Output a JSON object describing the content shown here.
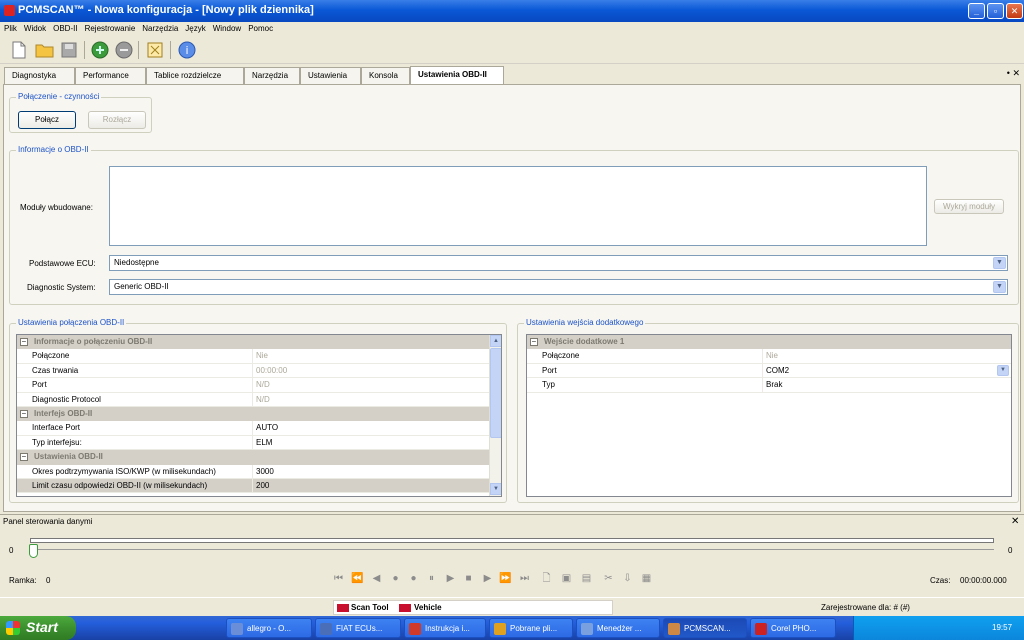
{
  "window": {
    "title": "PCMSCAN™ - Nowa konfiguracja - [Nowy plik dziennika]"
  },
  "menu": [
    "Plik",
    "Widok",
    "OBD-II",
    "Rejestrowanie",
    "Narzędzia",
    "Język",
    "Window",
    "Pomoc"
  ],
  "toolbar": {
    "icons": [
      "new-file-icon",
      "open-folder-icon",
      "save-icon",
      "connect-icon",
      "disconnect-icon",
      "settings-icon",
      "help-icon"
    ]
  },
  "tabs": [
    "Diagnostyka",
    "Performance",
    "Tablice rozdzielcze",
    "Narzędzia",
    "Ustawienia",
    "Konsola",
    "Ustawienia OBD-II"
  ],
  "tabs_active": "Ustawienia OBD-II",
  "tab_controls": {
    "pin": "•",
    "close": "✕"
  },
  "connection_group": {
    "title": "Połączenie - czynności",
    "connect_label": "Połącz",
    "disconnect_label": "Rozłącz"
  },
  "obd_info": {
    "title": "Informacje o OBD-II",
    "modules_label": "Moduły wbudowane:",
    "detect_label": "Wykryj moduły",
    "base_ecu_label": "Podstawowe ECU:",
    "base_ecu_value": "Niedostępne",
    "diag_system_label": "Diagnostic System:",
    "diag_system_value": "Generic OBD-II"
  },
  "obd_settings": {
    "title": "Ustawienia połączenia OBD-II",
    "rows": [
      {
        "type": "category",
        "label": "Informacje o połączeniu OBD-II"
      },
      {
        "type": "prop",
        "label": "Połączone",
        "value": "Nie",
        "dim": true
      },
      {
        "type": "prop",
        "label": "Czas trwania",
        "value": "00:00:00",
        "dim": true
      },
      {
        "type": "prop",
        "label": "Port",
        "value": "N/D",
        "dim": true
      },
      {
        "type": "prop",
        "label": "Diagnostic Protocol",
        "value": "N/D",
        "dim": true
      },
      {
        "type": "category",
        "label": "Interfejs OBD-II"
      },
      {
        "type": "prop",
        "label": "Interface Port",
        "value": "AUTO",
        "dim": false
      },
      {
        "type": "prop",
        "label": "Typ interfejsu:",
        "value": "ELM",
        "dim": false
      },
      {
        "type": "category",
        "label": "Ustawienia OBD-II"
      },
      {
        "type": "prop",
        "label": "Okres podtrzymywania ISO/KWP (w milisekundach)",
        "value": "3000",
        "dim": false
      },
      {
        "type": "prop",
        "label": "Limit czasu odpowiedzi OBD-II (w milisekundach)",
        "value": "200",
        "dim": false,
        "selected": true
      }
    ]
  },
  "aux_settings": {
    "title": "Ustawienia wejścia dodatkowego",
    "rows": [
      {
        "type": "category",
        "label": "Wejście dodatkowe 1"
      },
      {
        "type": "prop",
        "label": "Połączone",
        "value": "Nie",
        "dim": true
      },
      {
        "type": "prop",
        "label": "Port",
        "value": "COM2",
        "dim": false,
        "dropdown": true
      },
      {
        "type": "prop",
        "label": "Typ",
        "value": "Brak",
        "dim": false
      }
    ]
  },
  "data_panel": {
    "title": "Panel sterowania danymi",
    "slider_min": "0",
    "slider_max": "0",
    "frame_label": "Ramka:",
    "frame_value": "0",
    "time_label": "Czas:",
    "time_value": "00:00:00.000"
  },
  "statusbar": {
    "scan_tool": "Scan Tool",
    "vehicle": "Vehicle",
    "registered": "Zarejestrowane dla: # (#)"
  },
  "taskbar": {
    "start": "Start",
    "tasks": [
      "allegro - O...",
      "FIAT ECUs...",
      "Instrukcja i...",
      "Pobrane pli...",
      "Menedżer ...",
      "PCMSCAN...",
      "Corel PHO..."
    ],
    "active_task": "PCMSCAN...",
    "clock": "19:57"
  }
}
